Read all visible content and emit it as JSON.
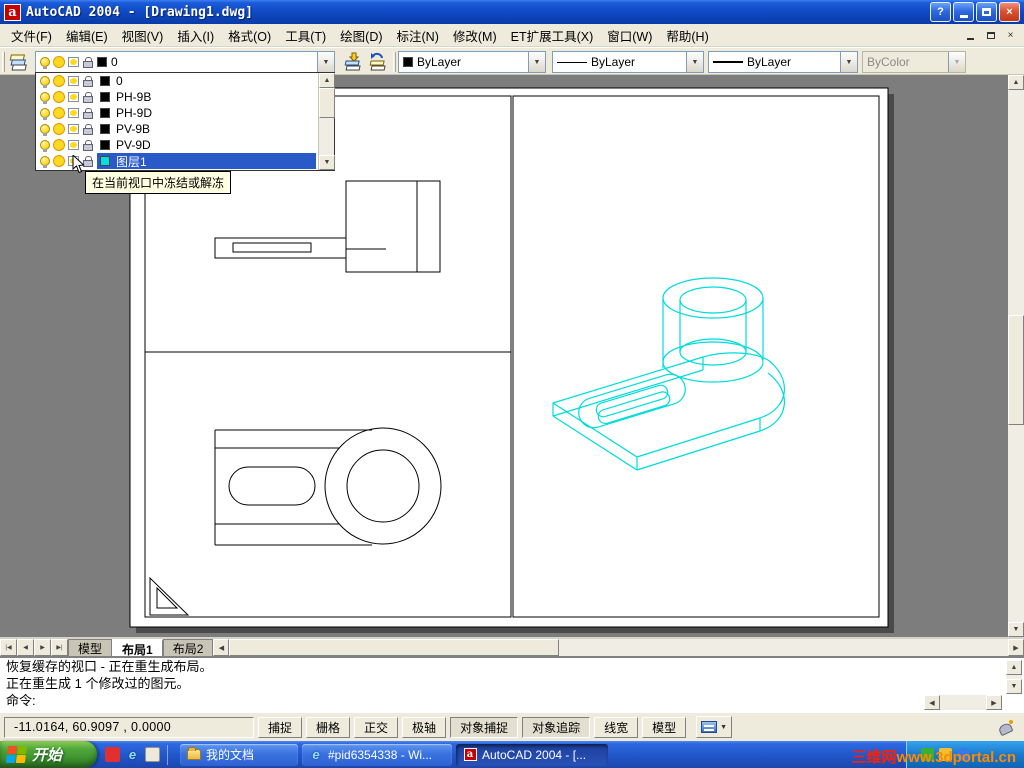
{
  "window": {
    "title": "AutoCAD 2004 - [Drawing1.dwg]",
    "app_icon_letter": "a",
    "controls": {
      "help": "?",
      "close": "×"
    }
  },
  "menu_bar": {
    "items": [
      "文件(F)",
      "编辑(E)",
      "视图(V)",
      "插入(I)",
      "格式(O)",
      "工具(T)",
      "绘图(D)",
      "标注(N)",
      "修改(M)",
      "ET扩展工具(X)",
      "窗口(W)",
      "帮助(H)"
    ]
  },
  "layer_toolbar": {
    "current_layer": "0",
    "current_color": "#000000",
    "dropdown": {
      "items": [
        {
          "name": "0",
          "color": "#000000"
        },
        {
          "name": "PH-9B",
          "color": "#000000"
        },
        {
          "name": "PH-9D",
          "color": "#000000"
        },
        {
          "name": "PV-9B",
          "color": "#000000"
        },
        {
          "name": "PV-9D",
          "color": "#000000"
        },
        {
          "name": "图层1",
          "color": "#00E0E0",
          "selected": true
        }
      ],
      "tooltip": "在当前视口中冻结或解冻"
    }
  },
  "properties_toolbar": {
    "color_value": "ByLayer",
    "linetype_value": "ByLayer",
    "lineweight_value": "ByLayer",
    "plot_style_value": "ByColor"
  },
  "layout_tabs": {
    "tabs": [
      "模型",
      "布局1",
      "布局2"
    ],
    "active_tab": "布局1"
  },
  "command_line": {
    "lines": [
      "恢复缓存的视口 - 正在重生成布局。",
      "正在重生成 1 个修改过的图元。"
    ],
    "prompt": "命令:"
  },
  "status_bar": {
    "coordinates": "-11.0164, 60.9097 , 0.0000",
    "buttons": [
      "捕捉",
      "栅格",
      "正交",
      "极轴",
      "对象捕捉",
      "对象追踪",
      "线宽",
      "模型"
    ]
  },
  "taskbar": {
    "start_label": "开始",
    "tasks": [
      {
        "label": "我的文档"
      },
      {
        "label": "#pid6354338 - Wi..."
      },
      {
        "label": "AutoCAD 2004 - [..."
      }
    ],
    "watermark": {
      "site_name": "三维网",
      "site_url": "www.3dportal.cn"
    }
  },
  "colors": {
    "accent_cyan": "#00E0E0",
    "selection_blue": "#2A5AC8",
    "wireframe_cyan": "#00DCDC"
  },
  "icons": {
    "dropdown_arrow": "▼",
    "up_arrow": "▲",
    "down_arrow": "▼",
    "left_arrow": "◀",
    "right_arrow": "▶",
    "tab_first": "|◀",
    "tab_prev": "◀",
    "tab_next": "▶",
    "tab_last": "▶|",
    "ie_letter": "e"
  }
}
